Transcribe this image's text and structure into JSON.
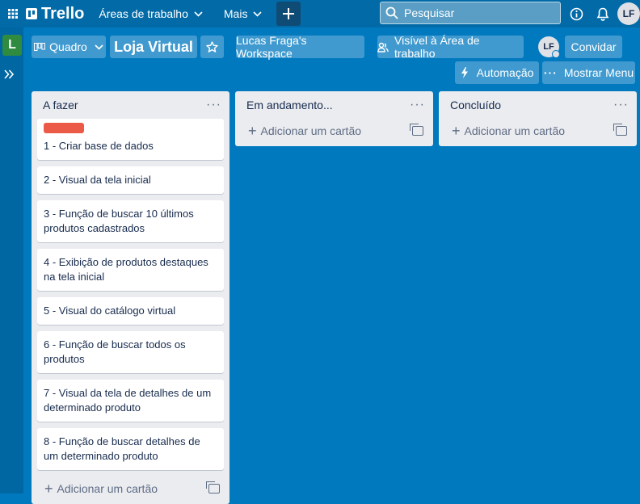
{
  "topnav": {
    "logo": "Trello",
    "workspaces": "Áreas de trabalho",
    "more": "Mais",
    "search_placeholder": "Pesquisar",
    "user_initials": "LF"
  },
  "sidebar": {
    "workspace_initial": "L"
  },
  "board": {
    "view": "Quadro",
    "title": "Loja Virtual",
    "workspace": "Lucas Fraga's Workspace",
    "visibility": "Visível à Área de trabalho",
    "member_initials": "LF",
    "invite": "Convidar",
    "automation": "Automação",
    "show_menu": "Mostrar Menu"
  },
  "lists": [
    {
      "title": "A fazer",
      "cards": [
        "1 - Criar base de dados",
        "2 - Visual da tela inicial",
        "3 - Função de buscar 10 últimos produtos cadastrados",
        "4 - Exibição de produtos destaques na tela inicial",
        "5 - Visual do catálogo virtual",
        "6 - Função de buscar todos os produtos",
        "7 - Visual da tela de detalhes de um determinado produto",
        "8 - Função de buscar detalhes de um determinado produto"
      ],
      "add_card": "Adicionar um cartão"
    },
    {
      "title": "Em andamento...",
      "cards": [],
      "add_card": "Adicionar um cartão"
    },
    {
      "title": "Concluído",
      "cards": [],
      "add_card": "Adicionar um cartão"
    }
  ],
  "colors": {
    "board_bg": "#0079bf",
    "nav_bg": "#026aa7",
    "label_red": "#eb5a46",
    "workspace_badge": "#2e8b3f"
  }
}
